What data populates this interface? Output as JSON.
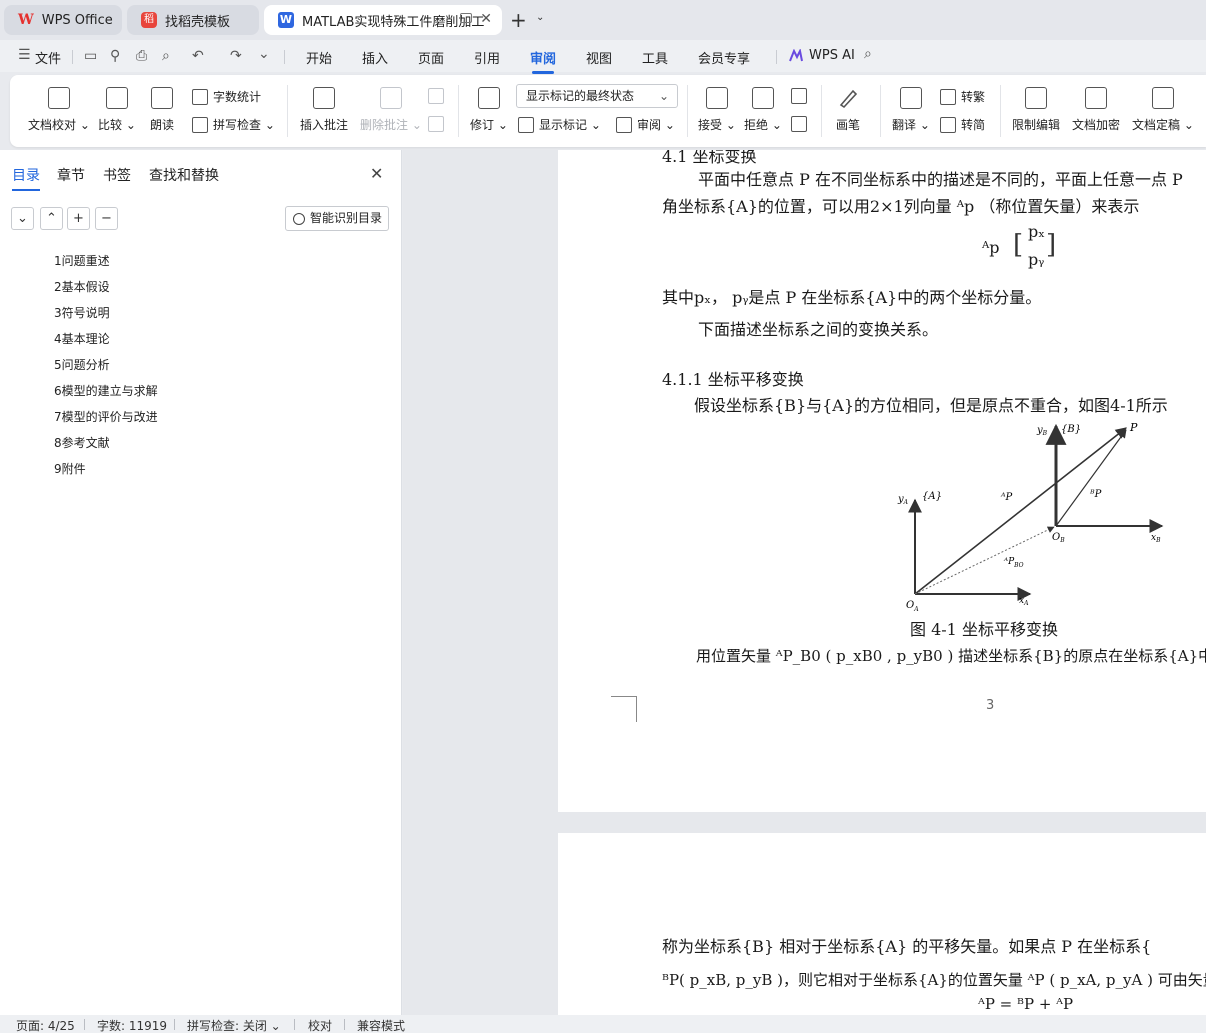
{
  "tabs": [
    {
      "label": "WPS Office",
      "icon": "wps-logo-icon"
    },
    {
      "label": "找稻壳模板",
      "icon": "docer-icon"
    },
    {
      "label": "MATLAB实现特殊工件磨削加工",
      "icon": "word-doc-icon"
    }
  ],
  "tabbar": {
    "new_tab": "+",
    "more": "⌄"
  },
  "menu": {
    "file": "文件",
    "items": [
      "开始",
      "插入",
      "页面",
      "引用",
      "审阅",
      "视图",
      "工具",
      "会员专享"
    ],
    "active": "审阅",
    "ai": "WPS AI"
  },
  "ribbon": {
    "doc_check": "文档校对",
    "compare": "比较",
    "read_aloud": "朗读",
    "word_count": "字数统计",
    "spell_check": "拼写检查",
    "insert_comment": "插入批注",
    "delete_comment": "删除批注",
    "track_changes": "修订",
    "markup_select": "显示标记的最终状态",
    "show_markup": "显示标记",
    "review": "审阅",
    "accept": "接受",
    "reject": "拒绝",
    "ink": "画笔",
    "translate": "翻译",
    "to_traditional": "转繁",
    "to_simplified": "转简",
    "restrict_edit": "限制编辑",
    "encrypt": "文档加密",
    "finalize": "文档定稿",
    "colors": {
      "accent": "#2266dd"
    }
  },
  "sidebar": {
    "tabs": [
      "目录",
      "章节",
      "书签",
      "查找和替换"
    ],
    "active_tab": "目录",
    "smart_toc": "智能识别目录",
    "toc": [
      "1问题重述",
      "2基本假设",
      "3符号说明",
      "4基本理论",
      "5问题分析",
      "6模型的建立与求解",
      "7模型的评价与改进",
      "8参考文献",
      "9附件"
    ]
  },
  "document": {
    "page1": {
      "heading": "4.1 坐标变换",
      "para1": "平面中任意点 P 在不同坐标系中的描述是不同的，平面上任意一点 P",
      "para1b": "角坐标系{A}的位置，可以用2×1列向量 ᴬp （称位置矢量）来表示",
      "vector_lhs": "ᴬp",
      "vector_top": "pₓ",
      "vector_bottom": "pᵧ",
      "para2": "其中pₓ， pᵧ是点 P 在坐标系{A}中的两个坐标分量。",
      "para3": "下面描述坐标系之间的变换关系。",
      "subheading": "4.1.1  坐标平移变换",
      "para4": "假设坐标系{B}与{A}的方位相同，但是原点不重合，如图4-1所示",
      "figure_caption": "图 4-1    坐标平移变换",
      "para5": "用位置矢量 ᴬP_B0 ( p_xB0 , p_yB0 ) 描述坐标系{B}的原点在坐标系{A}中",
      "page_number": "3"
    },
    "page2": {
      "line1": "称为坐标系{B} 相对于坐标系{A} 的平移矢量。如果点 P 在坐标系{",
      "line2": "ᴮP( p_xB, p_yB )，则它相对于坐标系{A}的位置矢量 ᴬP ( p_xA, p_yA ) 可由矢量",
      "line3": "ᴬP = ᴮP + ᴬP"
    },
    "figure": {
      "yA": "y",
      "yA_sub": "A",
      "A_set": "{A}",
      "yB": "y",
      "yB_sub": "B",
      "B_set": "{B}",
      "P": "P",
      "AP": "ᴬP",
      "BP": "ᴮP",
      "OB": "O",
      "OB_sub": "B",
      "xB": "x",
      "xB_sub": "B",
      "APB0": "ᴬP",
      "APB0_sub": "BO",
      "OA": "O",
      "OA_sub": "A",
      "xA": "x",
      "xA_sub": "A"
    }
  },
  "status": {
    "page": "页面: 4/25",
    "words": "字数: 11919",
    "spell": "拼写检查: 关闭",
    "proof": "校对",
    "compat": "兼容模式"
  }
}
